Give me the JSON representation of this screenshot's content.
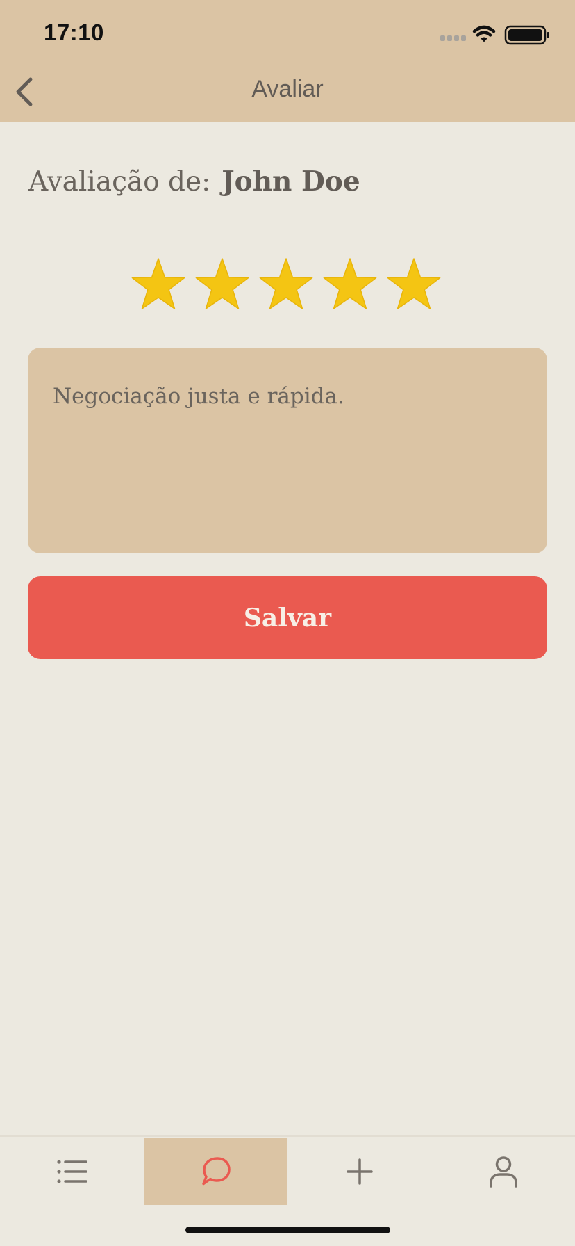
{
  "status_bar": {
    "time": "17:10",
    "icons": [
      "signal-icon",
      "wifi-icon",
      "battery-icon"
    ]
  },
  "header": {
    "title": "Avaliar",
    "back_icon": "chevron-left-icon"
  },
  "review": {
    "label": "Avaliação de:",
    "user_name": "John Doe",
    "rating": 5,
    "max_rating": 5,
    "comment": "Negociação justa e rápida."
  },
  "actions": {
    "save_label": "Salvar"
  },
  "tab_bar": {
    "tabs": [
      {
        "icon": "list-icon",
        "active": false
      },
      {
        "icon": "chat-bubble-icon",
        "active": true
      },
      {
        "icon": "plus-icon",
        "active": false
      },
      {
        "icon": "user-icon",
        "active": false
      }
    ]
  },
  "colors": {
    "header_bg": "#DBC4A4",
    "page_bg": "#ECE9E0",
    "accent": "#EA5A50",
    "star": "#F4C513",
    "text": "#666059"
  }
}
